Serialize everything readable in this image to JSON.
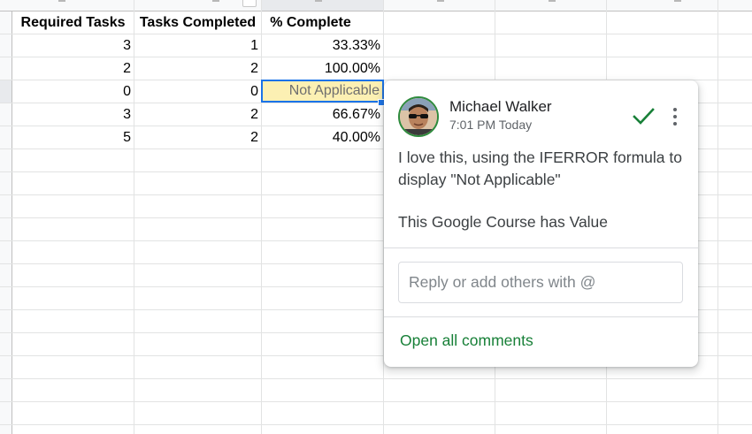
{
  "sheet": {
    "headers": [
      "Required Tasks",
      "Tasks Completed",
      "% Complete"
    ],
    "rows": [
      [
        "3",
        "1",
        "33.33%"
      ],
      [
        "2",
        "2",
        "100.00%"
      ],
      [
        "0",
        "0",
        "Not Applicable"
      ],
      [
        "3",
        "2",
        "66.67%"
      ],
      [
        "5",
        "2",
        "40.00%"
      ]
    ],
    "selected_cell_value": "Not Applicable",
    "colors": {
      "selected_fill": "#fcf0b3",
      "selection_border": "#1a73e8",
      "gridline": "#e2e3e3"
    }
  },
  "comment": {
    "author": "Michael Walker",
    "time": "7:01 PM Today",
    "body_line1": "I love this, using the IFERROR formula to display \"Not Applicable\"",
    "body_line2": "This Google Course has Value",
    "reply_placeholder": "Reply or add others with @",
    "open_all_label": "Open all comments",
    "icons": {
      "resolve": "checkmark-icon",
      "more": "more-vert-icon",
      "avatar": "avatar-photo"
    },
    "colors": {
      "accent": "#188038",
      "text": "#3c4043"
    }
  }
}
